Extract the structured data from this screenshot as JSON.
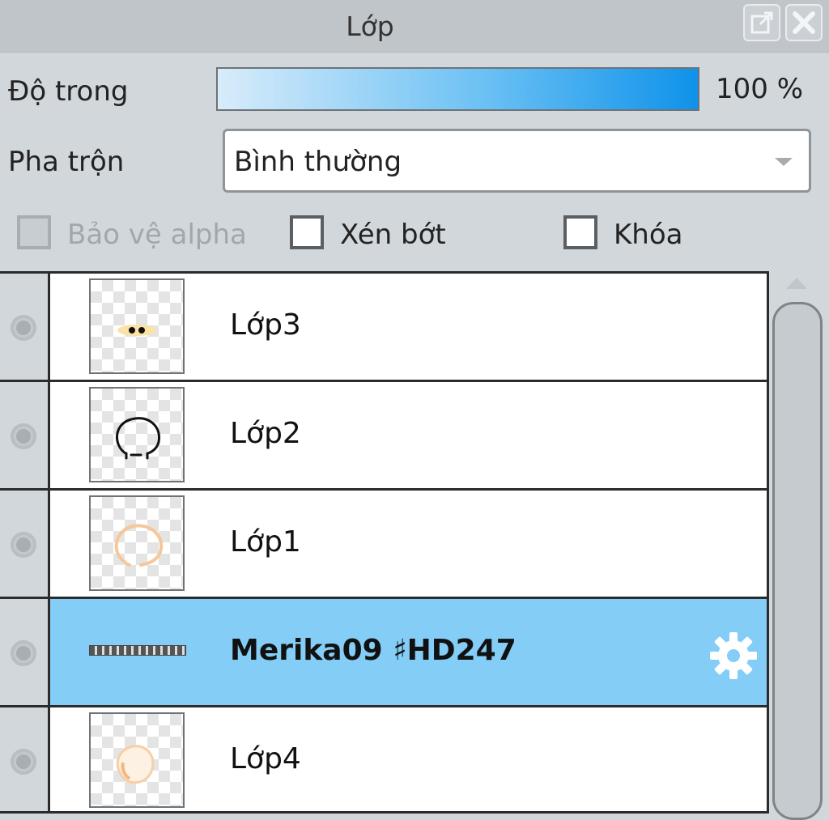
{
  "window": {
    "title": "Lớp"
  },
  "controls": {
    "opacity_label": "Độ trong",
    "opacity_percent": 100,
    "opacity_value_text": "100 %",
    "blend_label": "Pha trộn",
    "blend_value": "Bình thường",
    "checkboxes": [
      {
        "label": "Bảo vệ alpha",
        "checked": false,
        "disabled": true
      },
      {
        "label": "Xén bớt",
        "checked": false,
        "disabled": false
      },
      {
        "label": "Khóa",
        "checked": false,
        "disabled": false
      }
    ]
  },
  "layers": [
    {
      "name": "Lớp3",
      "thumb": "eyes-sketch",
      "selected": false
    },
    {
      "name": "Lớp2",
      "thumb": "head-outline-black",
      "selected": false
    },
    {
      "name": "Lớp1",
      "thumb": "head-outline-peach",
      "selected": false
    },
    {
      "name": "Merika09 ♯HD247",
      "thumb": "text-layer",
      "selected": true,
      "settings_icon": "gear-icon"
    },
    {
      "name": "Lớp4",
      "thumb": "head-fill-peach",
      "selected": false
    }
  ],
  "colors": {
    "panel_bg": "#d2d7dc",
    "selected_row": "#84cdf6",
    "opacity_fill_end": "#0f92ea"
  }
}
